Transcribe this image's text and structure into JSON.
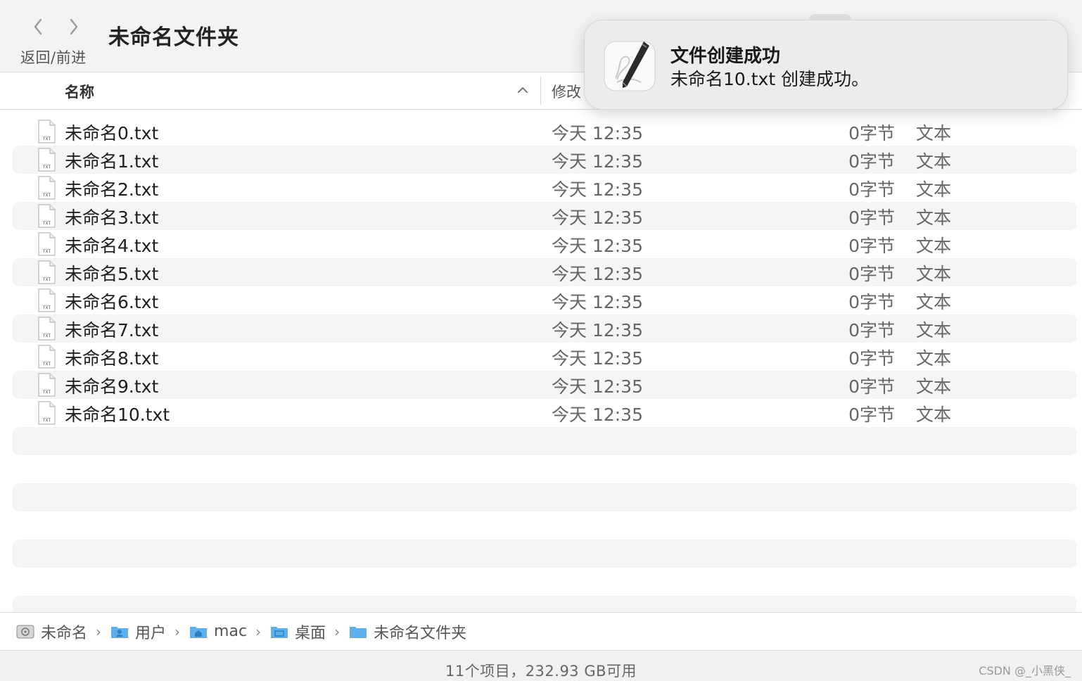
{
  "toolbar": {
    "nav_label": "返回/前进",
    "window_title": "未命名文件夹"
  },
  "columns": {
    "name": "名称",
    "modified": "修改"
  },
  "files": [
    {
      "name": "未命名0.txt",
      "date": "今天 12:35",
      "size": "0字节",
      "kind": "文本"
    },
    {
      "name": "未命名1.txt",
      "date": "今天 12:35",
      "size": "0字节",
      "kind": "文本"
    },
    {
      "name": "未命名2.txt",
      "date": "今天 12:35",
      "size": "0字节",
      "kind": "文本"
    },
    {
      "name": "未命名3.txt",
      "date": "今天 12:35",
      "size": "0字节",
      "kind": "文本"
    },
    {
      "name": "未命名4.txt",
      "date": "今天 12:35",
      "size": "0字节",
      "kind": "文本"
    },
    {
      "name": "未命名5.txt",
      "date": "今天 12:35",
      "size": "0字节",
      "kind": "文本"
    },
    {
      "name": "未命名6.txt",
      "date": "今天 12:35",
      "size": "0字节",
      "kind": "文本"
    },
    {
      "name": "未命名7.txt",
      "date": "今天 12:35",
      "size": "0字节",
      "kind": "文本"
    },
    {
      "name": "未命名8.txt",
      "date": "今天 12:35",
      "size": "0字节",
      "kind": "文本"
    },
    {
      "name": "未命名9.txt",
      "date": "今天 12:35",
      "size": "0字节",
      "kind": "文本"
    },
    {
      "name": "未命名10.txt",
      "date": "今天 12:35",
      "size": "0字节",
      "kind": "文本"
    }
  ],
  "file_icon_label": "TXT",
  "path": [
    {
      "label": "未命名",
      "icon": "disk-icon"
    },
    {
      "label": "用户",
      "icon": "folder-users-icon"
    },
    {
      "label": "mac",
      "icon": "folder-home-icon"
    },
    {
      "label": "桌面",
      "icon": "folder-desktop-icon"
    },
    {
      "label": "未命名文件夹",
      "icon": "folder-icon"
    }
  ],
  "status": {
    "text": "11个项目，232.93 GB可用",
    "watermark": "CSDN @_小黑侠_"
  },
  "notification": {
    "title": "文件创建成功",
    "body": "未命名10.txt 创建成功。",
    "icon": "script-editor-icon"
  },
  "colors": {
    "accent_folder": "#5fb0ea",
    "stripe": "#f4f5f5"
  }
}
